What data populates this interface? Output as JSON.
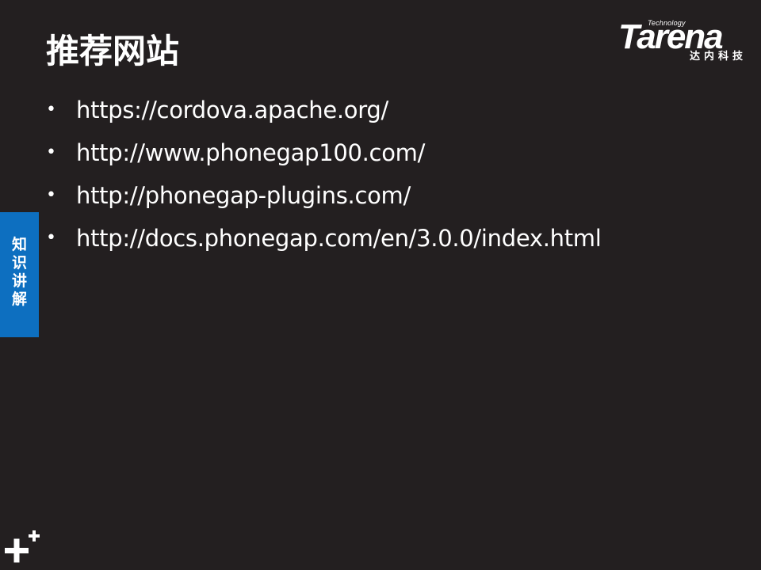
{
  "slide": {
    "title": "推荐网站",
    "background": "#231f20",
    "accent": "#0d6fc0"
  },
  "logo": {
    "tagline": "Technology",
    "brand": "Tarena",
    "chinese": "达内科技"
  },
  "links": [
    {
      "bullet": "•",
      "text": "https://cordova.apache.org/"
    },
    {
      "bullet": "•",
      "text": "http://www.phonegap100.com/"
    },
    {
      "bullet": "•",
      "text": "http://phonegap-plugins.com/"
    },
    {
      "bullet": "•",
      "text": "http://docs.phonegap.com/en/3.0.0/index.html"
    }
  ],
  "side_tab": {
    "label": "知识讲解"
  },
  "icons": {
    "corner": "plus-plus-icon"
  }
}
